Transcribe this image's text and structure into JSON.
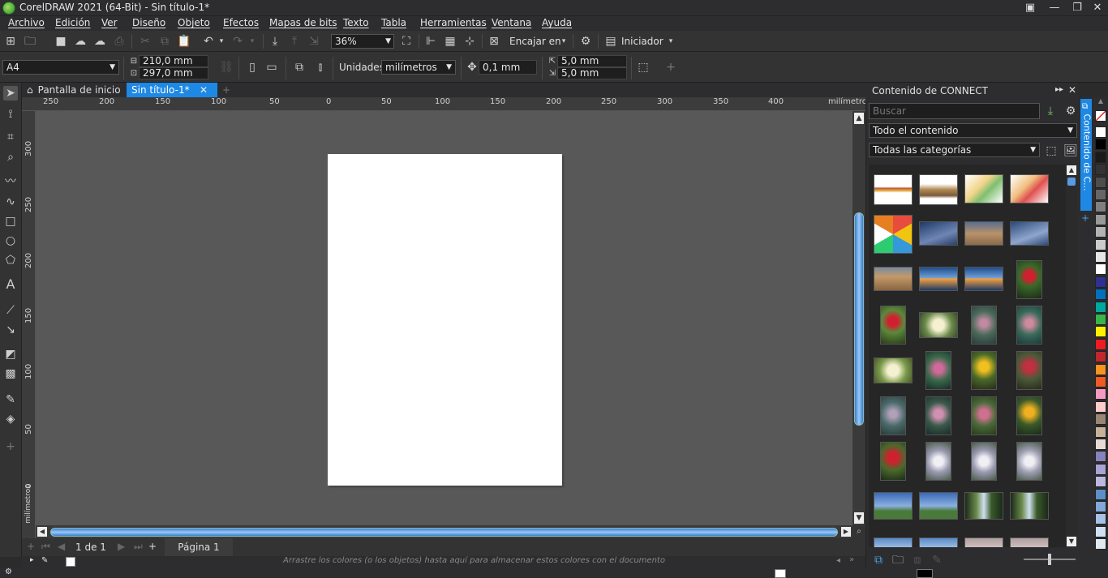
{
  "window": {
    "title": "CorelDRAW 2021 (64-Bit) - Sin título-1*"
  },
  "menu": [
    "Archivo",
    "Edición",
    "Ver",
    "Diseño",
    "Objeto",
    "Efectos",
    "Mapas de bits",
    "Texto",
    "Tabla",
    "Herramientas",
    "Ventana",
    "Ayuda"
  ],
  "toolbar": {
    "zoom_value": "36%",
    "snap_label": "Encajar en",
    "workspace_label": "Iniciador"
  },
  "property_bar": {
    "page_size": "A4",
    "width": "210,0 mm",
    "height": "297,0 mm",
    "units_label": "Unidades:",
    "units_value": "milímetros",
    "nudge": "0,1 mm",
    "dup_x": "5,0 mm",
    "dup_y": "5,0 mm"
  },
  "doc_tabs": [
    {
      "label": "Pantalla de inicio",
      "active": false
    },
    {
      "label": "Sin título-1*",
      "active": true
    }
  ],
  "ruler": {
    "h_ticks": [
      "250",
      "200",
      "150",
      "100",
      "50",
      "0",
      "50",
      "100",
      "150",
      "200",
      "250",
      "300",
      "350",
      "400"
    ],
    "h_unit": "milímetros",
    "v_ticks": [
      "300",
      "250",
      "200",
      "150",
      "100",
      "50",
      "0"
    ],
    "v_unit": "milímetros"
  },
  "page_nav": {
    "counter": "1 de 1",
    "page_tab": "Página 1"
  },
  "color_doc_hint": "Arrastre los colores (o los objetos) hasta aquí para almacenar estos colores con el documento",
  "connect": {
    "title": "Contenido de CONNECT",
    "search_placeholder": "Buscar",
    "filter_content": "Todo el contenido",
    "filter_categories": "Todas las categorías",
    "side_tab": "Contenido de C..."
  },
  "colors": {
    "accent": "#1e88e5",
    "canvas": "#585858",
    "page": "#ffffff",
    "palette": [
      "#ffffff",
      "#000000",
      "#1a1a1a",
      "#333333",
      "#4d4d4d",
      "#666666",
      "#808080",
      "#999999",
      "#b3b3b3",
      "#cccccc",
      "#e6e6e6",
      "#ffffff",
      "#2e3192",
      "#0071bc",
      "#00a99d",
      "#39b54a",
      "#fff200",
      "#ed1c24",
      "#c1272d",
      "#f7931e",
      "#f15a24",
      "#f49ac1",
      "#ffcccc",
      "#998675",
      "#c7b299",
      "#e6dcd3",
      "#8781bd",
      "#a8a4d4",
      "#bcb8e0",
      "#5c8fc7",
      "#81a8d8",
      "#a6c2e6",
      "#cfe0f2",
      "#e0e8f2"
    ]
  }
}
